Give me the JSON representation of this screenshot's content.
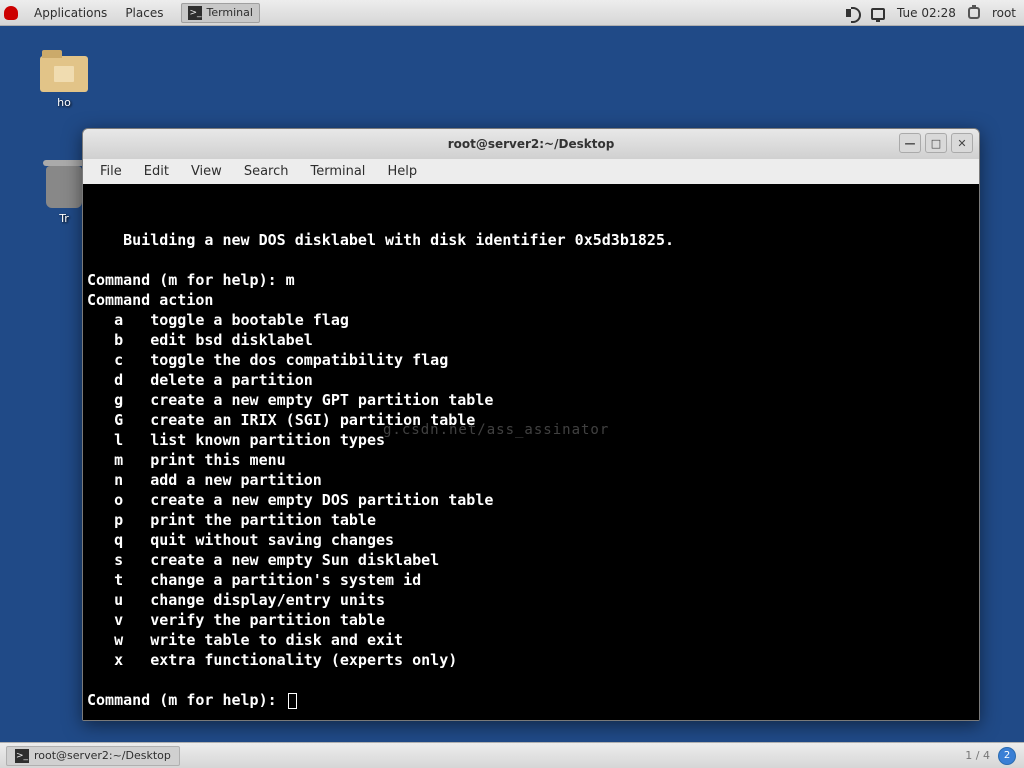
{
  "top_panel": {
    "menus": [
      "Applications",
      "Places"
    ],
    "taskbar_item": "Terminal",
    "clock": "Tue 02:28",
    "user": "root"
  },
  "desktop": {
    "home_label": "ho",
    "trash_label": "Tr"
  },
  "window": {
    "title": "root@server2:~/Desktop",
    "menus": [
      "File",
      "Edit",
      "View",
      "Search",
      "Terminal",
      "Help"
    ],
    "controls": {
      "min": "—",
      "max": "□",
      "close": "✕"
    }
  },
  "terminal": {
    "line_build": "Building a new DOS disklabel with disk identifier 0x5d3b1825.",
    "prompt1": "Command (m for help): m",
    "action_header": "Command action",
    "actions": [
      {
        "k": "a",
        "d": "toggle a bootable flag"
      },
      {
        "k": "b",
        "d": "edit bsd disklabel"
      },
      {
        "k": "c",
        "d": "toggle the dos compatibility flag"
      },
      {
        "k": "d",
        "d": "delete a partition"
      },
      {
        "k": "g",
        "d": "create a new empty GPT partition table"
      },
      {
        "k": "G",
        "d": "create an IRIX (SGI) partition table"
      },
      {
        "k": "l",
        "d": "list known partition types"
      },
      {
        "k": "m",
        "d": "print this menu"
      },
      {
        "k": "n",
        "d": "add a new partition"
      },
      {
        "k": "o",
        "d": "create a new empty DOS partition table"
      },
      {
        "k": "p",
        "d": "print the partition table"
      },
      {
        "k": "q",
        "d": "quit without saving changes"
      },
      {
        "k": "s",
        "d": "create a new empty Sun disklabel"
      },
      {
        "k": "t",
        "d": "change a partition's system id"
      },
      {
        "k": "u",
        "d": "change display/entry units"
      },
      {
        "k": "v",
        "d": "verify the partition table"
      },
      {
        "k": "w",
        "d": "write table to disk and exit"
      },
      {
        "k": "x",
        "d": "extra functionality (experts only)"
      }
    ],
    "prompt2": "Command (m for help): ",
    "watermark": "g.csdn.net/ass_assinator"
  },
  "bottom_panel": {
    "task": "root@server2:~/Desktop",
    "pager": "1 / 4",
    "ws": "2"
  }
}
